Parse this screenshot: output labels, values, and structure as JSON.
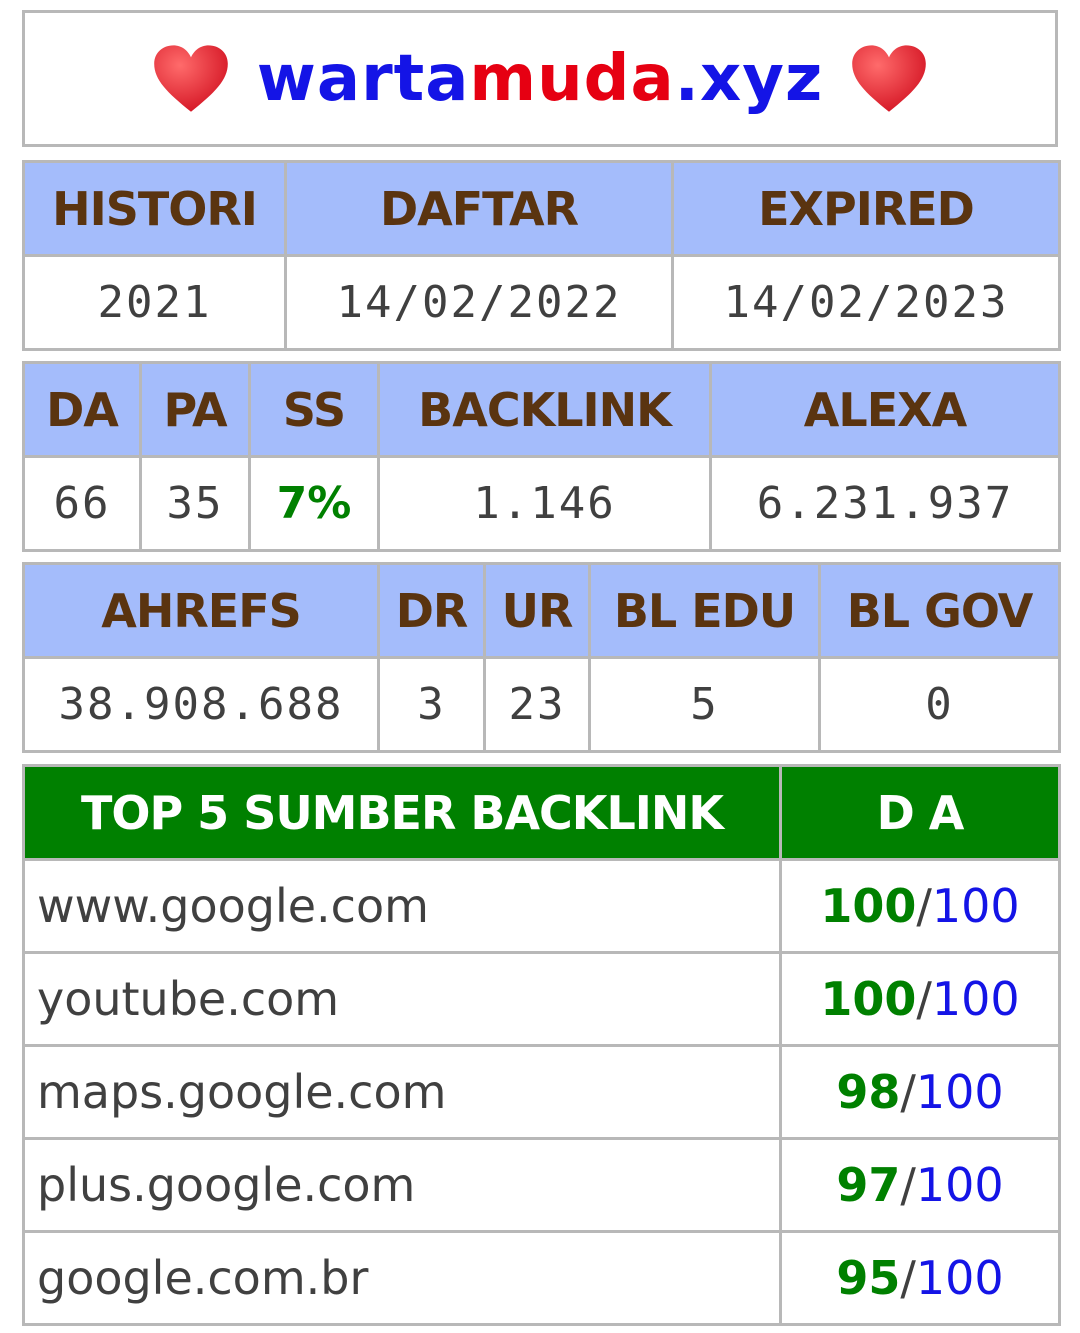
{
  "site": {
    "name_part1": "warta",
    "name_part2": "muda",
    "name_part3": ".xyz",
    "heart_icon": "heart-icon",
    "colors": {
      "blue": "#1414e6",
      "red": "#e60012"
    }
  },
  "dates": {
    "headers": [
      "HISTORI",
      "DAFTAR",
      "EXPIRED"
    ],
    "values": [
      "2021",
      "14/02/2022",
      "14/02/2023"
    ]
  },
  "metrics": {
    "headers": [
      "DA",
      "PA",
      "SS",
      "BACKLINK",
      "ALEXA"
    ],
    "values": [
      "66",
      "35",
      "7%",
      "1.146",
      "6.231.937"
    ]
  },
  "ahrefs": {
    "headers": [
      "AHREFS",
      "DR",
      "UR",
      "BL EDU",
      "BL GOV"
    ],
    "values": [
      "38.908.688",
      "3",
      "23",
      "5",
      "0"
    ]
  },
  "backlinks": {
    "headers": [
      "TOP 5 SUMBER BACKLINK",
      "D A"
    ],
    "header_color": "#008000",
    "rows": [
      {
        "source": "www.google.com",
        "da": "100",
        "max": "100"
      },
      {
        "source": "youtube.com",
        "da": "100",
        "max": "100"
      },
      {
        "source": "maps.google.com",
        "da": "98",
        "max": "100"
      },
      {
        "source": "plus.google.com",
        "da": "97",
        "max": "100"
      },
      {
        "source": "google.com.br",
        "da": "95",
        "max": "100"
      }
    ],
    "separator": "/"
  }
}
